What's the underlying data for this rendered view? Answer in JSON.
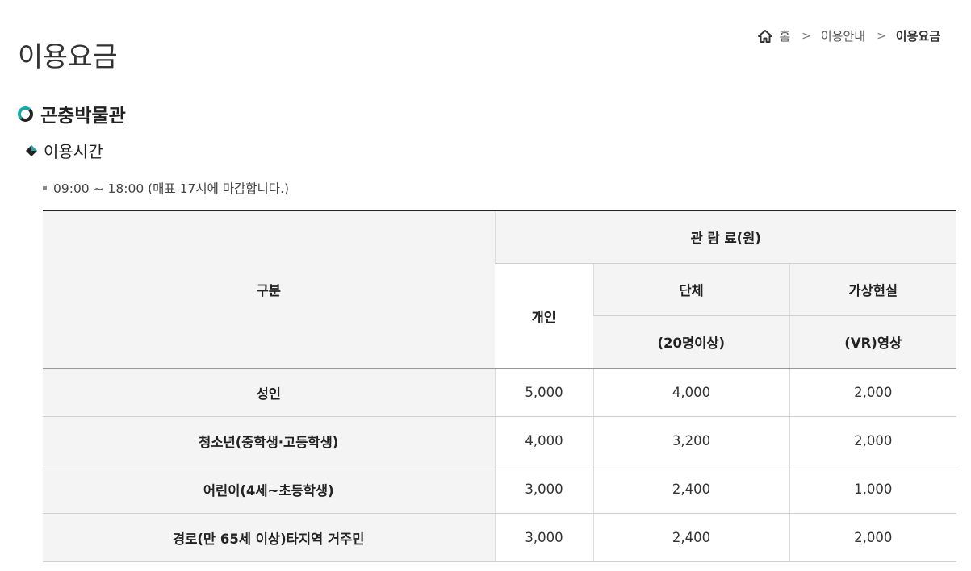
{
  "page": {
    "title": "이용요금"
  },
  "breadcrumb": {
    "home": "홈",
    "sep1": ">",
    "section": "이용안내",
    "sep2": ">",
    "current": "이용요금"
  },
  "section": {
    "title": "곤충박물관",
    "subtitle": "이용시간"
  },
  "hours": {
    "text": "09:00 ~ 18:00 (매표 17시에 마감합니다.)"
  },
  "table": {
    "header": {
      "category": "구분",
      "fee_group": "관 람 료(원)",
      "individual": "개인",
      "group": "단체",
      "group_note": "(20명이상)",
      "vr": "가상현실",
      "vr_note": "(VR)영상"
    },
    "rows": [
      {
        "category": "성인",
        "individual": "5,000",
        "group": "4,000",
        "vr": "2,000"
      },
      {
        "category": "청소년(중학생·고등학생)",
        "individual": "4,000",
        "group": "3,200",
        "vr": "2,000"
      },
      {
        "category": "어린이(4세~초등학생)",
        "individual": "3,000",
        "group": "2,400",
        "vr": "1,000"
      },
      {
        "category": "경로(만 65세 이상)타지역 거주민",
        "individual": "3,000",
        "group": "2,400",
        "vr": "2,000"
      }
    ]
  },
  "colors": {
    "accent": "#1aa9a9",
    "header_bg": "#f4f4f4",
    "border_top": "#222222"
  }
}
